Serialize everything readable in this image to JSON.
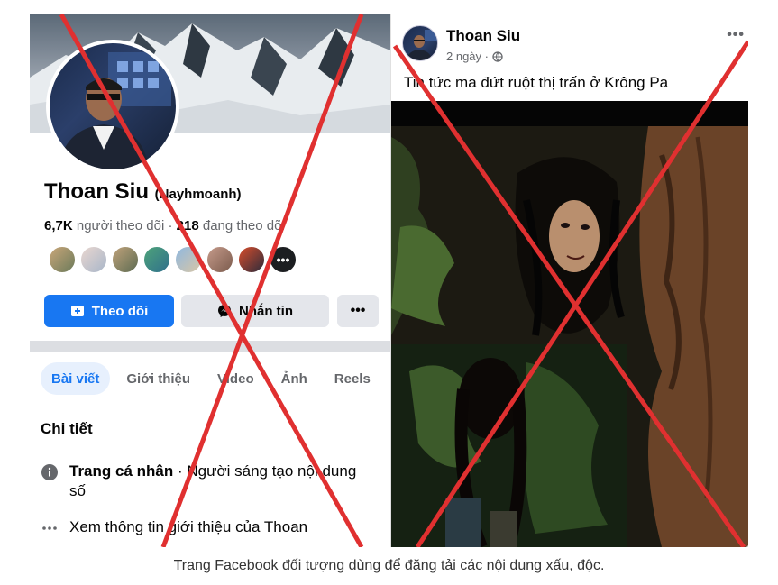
{
  "profile": {
    "name": "Thoan Siu",
    "nickname": "(Nayhmoanh)",
    "followers_count": "6,7K",
    "followers_label": "người theo dõi",
    "following_count": "218",
    "following_label": "đang theo dõi",
    "more_friends_glyph": "•••"
  },
  "actions": {
    "follow_label": "Theo dõi",
    "message_label": "Nhắn tin",
    "more_label": "•••",
    "follow_color": "#1877f2"
  },
  "tabs": [
    {
      "label": "Bài viết",
      "active": true
    },
    {
      "label": "Giới thiệu",
      "active": false
    },
    {
      "label": "Video",
      "active": false
    },
    {
      "label": "Ảnh",
      "active": false
    },
    {
      "label": "Reels",
      "active": false
    }
  ],
  "details": {
    "title": "Chi tiết",
    "rows": [
      {
        "icon": "info-icon",
        "strong": "Trang cá nhân",
        "text": " · Người sáng tạo nội dung số"
      },
      {
        "icon": "ellipsis-icon",
        "strong": "",
        "text": "Xem thông tin giới thiệu của Thoan"
      }
    ]
  },
  "post": {
    "author": "Thoan Siu",
    "time": "2 ngày ·",
    "privacy_icon": "globe-icon",
    "menu": "•••",
    "text": "Tin tức ma đứt ruột thị trấn ở Krông Pa"
  },
  "overlay": {
    "cross_color": "#e03030"
  },
  "caption": "Trang Facebook đối tượng dùng để đăng tải các nội dung xấu, độc."
}
